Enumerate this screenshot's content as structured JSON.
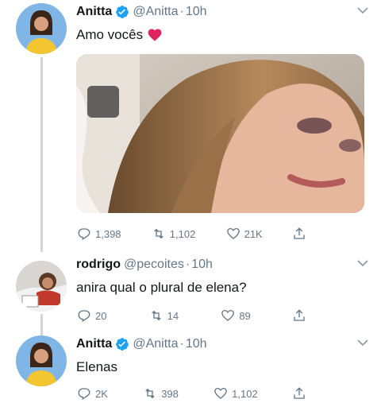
{
  "tweets": [
    {
      "name": "Anitta",
      "handle": "@Anitta",
      "time": "10h",
      "text": "Amo vocês",
      "replies": "1,398",
      "retweets": "1,102",
      "likes": "21K",
      "verified": true
    },
    {
      "name": "rodrigo",
      "handle": "@pecoites",
      "time": "10h",
      "text": "anira qual o plural de elena?",
      "replies": "20",
      "retweets": "14",
      "likes": "89",
      "verified": false
    },
    {
      "name": "Anitta",
      "handle": "@Anitta",
      "time": "10h",
      "text": "Elenas",
      "replies": "2K",
      "retweets": "398",
      "likes": "1,102",
      "verified": true
    }
  ],
  "separator": "·",
  "colors": {
    "verified": "#1da1f2",
    "secondary_text": "#657786",
    "heart_emoji": "#e0245e",
    "thread_line": "#cfd5da"
  }
}
